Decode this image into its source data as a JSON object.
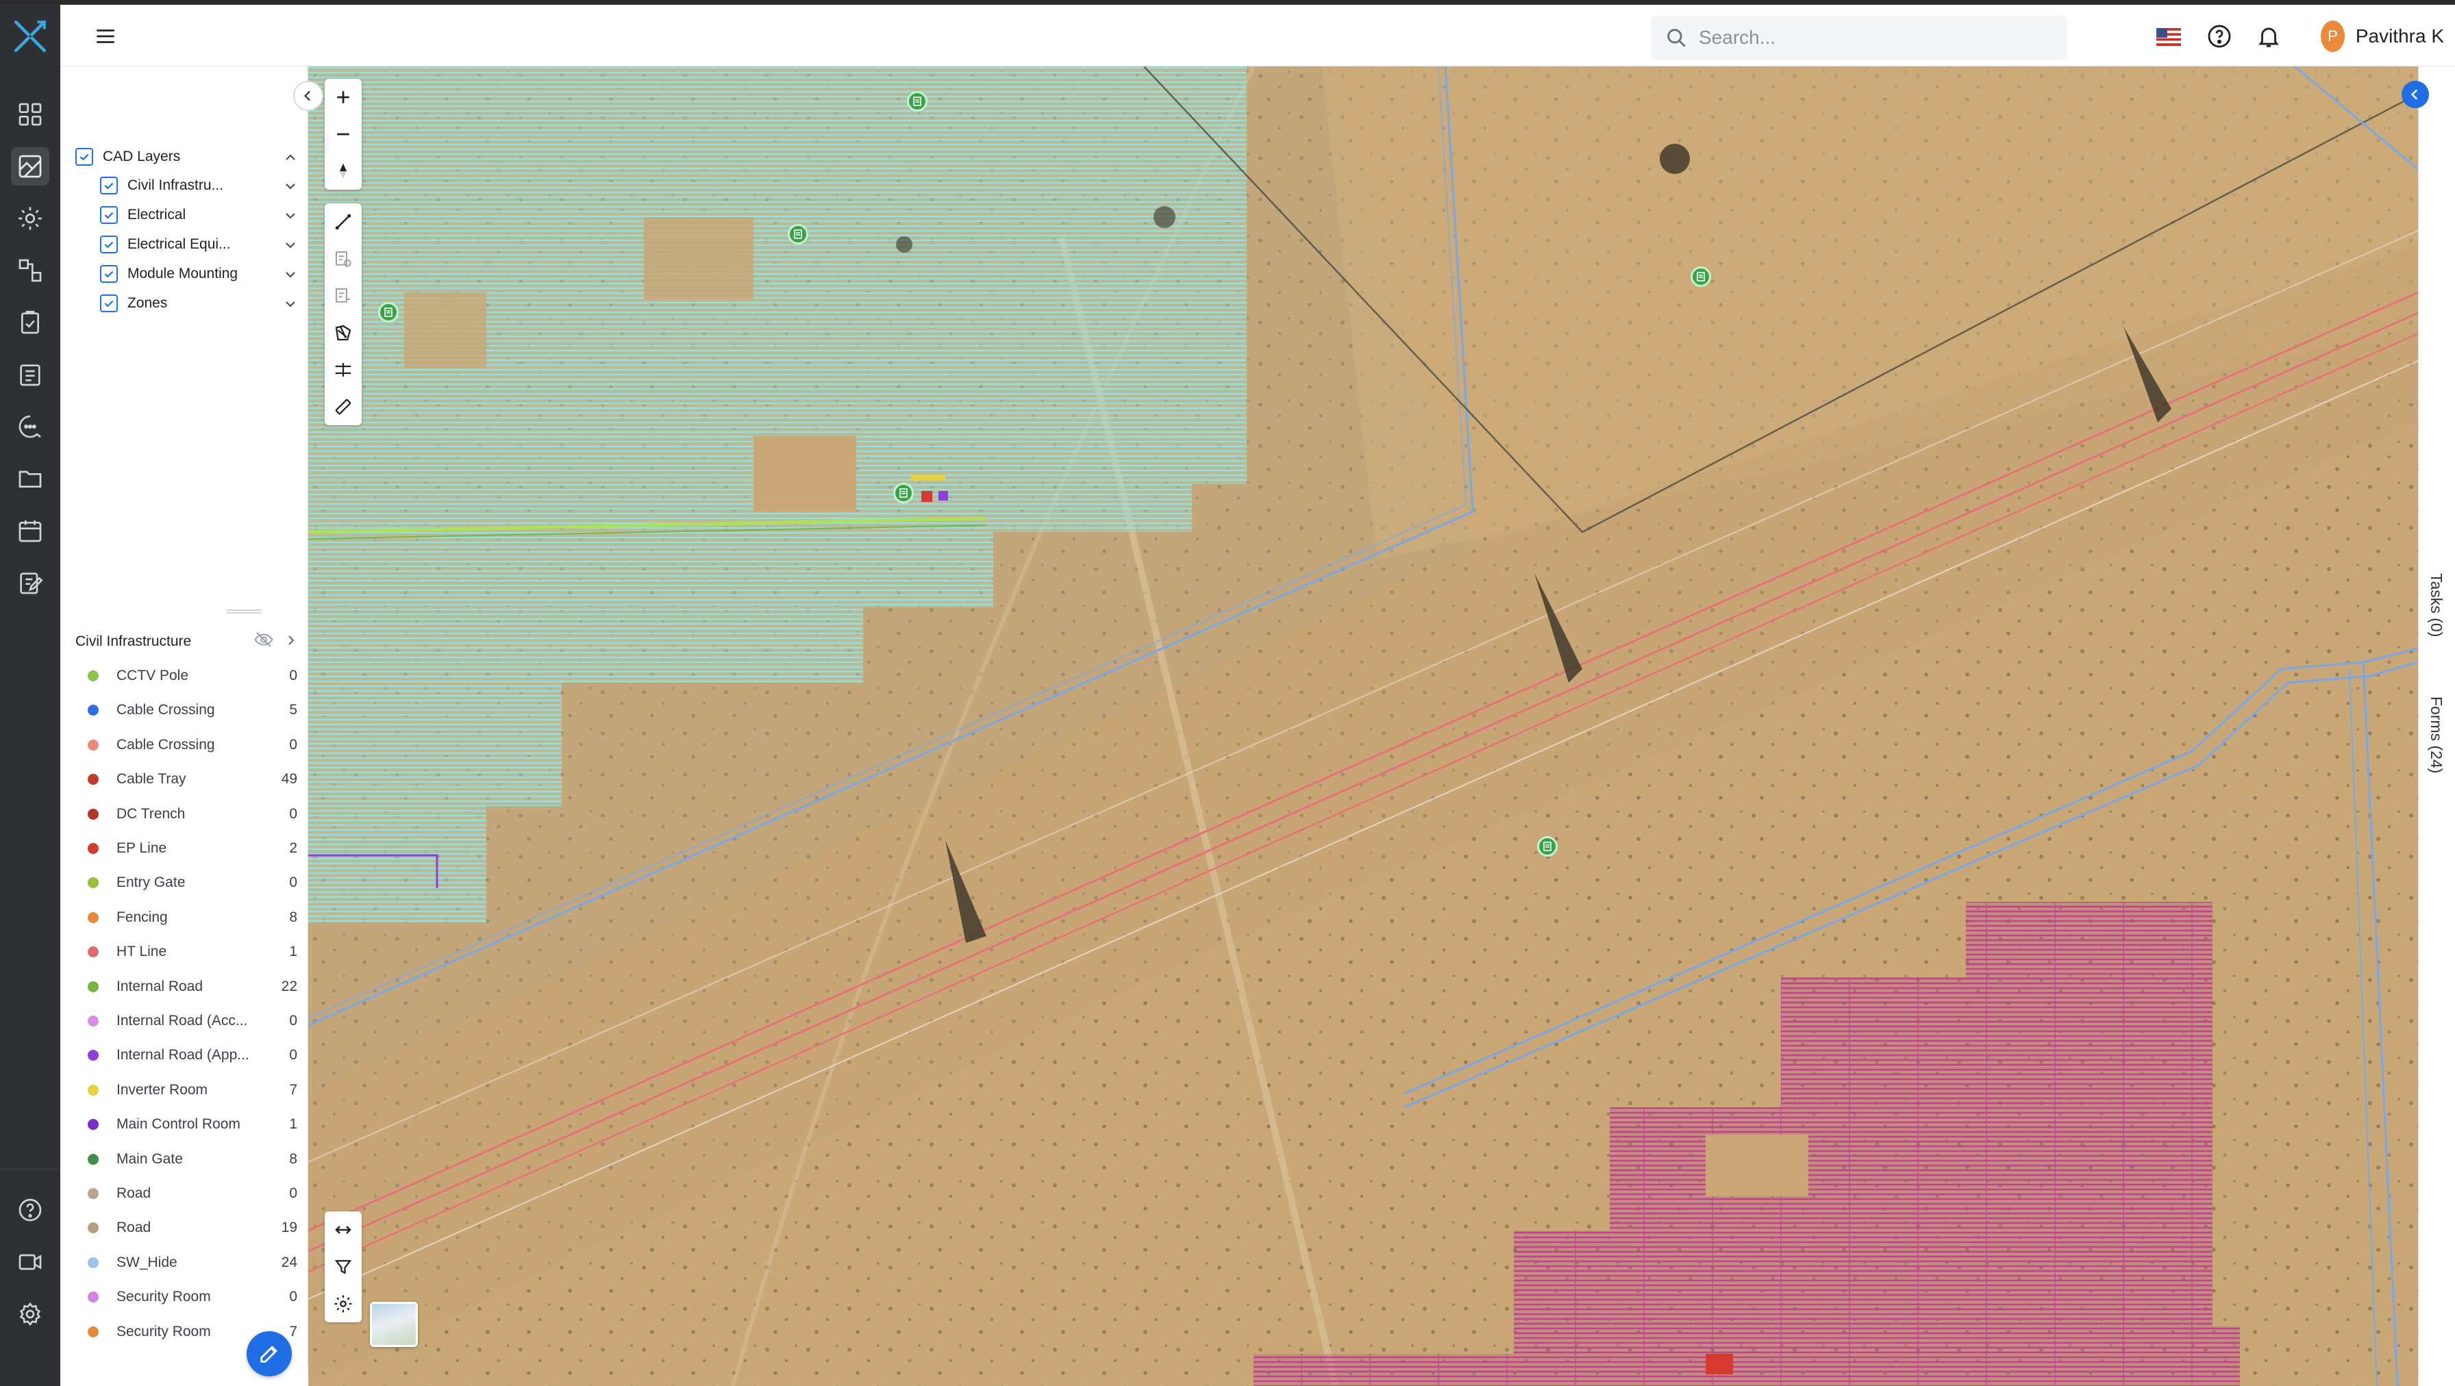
{
  "header": {
    "search_placeholder": "Search...",
    "user_initial": "P",
    "user_name": "Pavithra K"
  },
  "layers": {
    "root": {
      "label": "CAD Layers",
      "checked": true
    },
    "children": [
      {
        "label": "Civil Infrastru...",
        "checked": true
      },
      {
        "label": "Electrical",
        "checked": true
      },
      {
        "label": "Electrical Equi...",
        "checked": true
      },
      {
        "label": "Module Mounting",
        "checked": true
      },
      {
        "label": "Zones",
        "checked": true
      }
    ]
  },
  "legend": {
    "title": "Civil Infrastructure",
    "items": [
      {
        "label": "CCTV Pole",
        "count": "0",
        "color": "#8bc34a"
      },
      {
        "label": "Cable Crossing",
        "count": "5",
        "color": "#2f6fe4"
      },
      {
        "label": "Cable Crossing",
        "count": "0",
        "color": "#e8897a"
      },
      {
        "label": "Cable Tray",
        "count": "49",
        "color": "#c0392b"
      },
      {
        "label": "DC Trench",
        "count": "0",
        "color": "#b8332a"
      },
      {
        "label": "EP Line",
        "count": "2",
        "color": "#d63a2e"
      },
      {
        "label": "Entry Gate",
        "count": "0",
        "color": "#9bbf3b"
      },
      {
        "label": "Fencing",
        "count": "8",
        "color": "#e8893a"
      },
      {
        "label": "HT Line",
        "count": "1",
        "color": "#e06c6c"
      },
      {
        "label": "Internal Road",
        "count": "22",
        "color": "#7cb342"
      },
      {
        "label": "Internal Road (Acc...",
        "count": "0",
        "color": "#d98ee6"
      },
      {
        "label": "Internal Road (App...",
        "count": "0",
        "color": "#8e3fd6"
      },
      {
        "label": "Inverter Room",
        "count": "7",
        "color": "#e6d23a"
      },
      {
        "label": "Main Control Room",
        "count": "1",
        "color": "#7b2fc9"
      },
      {
        "label": "Main Gate",
        "count": "8",
        "color": "#3f8f4a"
      },
      {
        "label": "Road",
        "count": "0",
        "color": "#b9a58c"
      },
      {
        "label": "Road",
        "count": "19",
        "color": "#b59f84"
      },
      {
        "label": "SW_Hide",
        "count": "24",
        "color": "#9ec3ea"
      },
      {
        "label": "Security Room",
        "count": "0",
        "color": "#d383e0"
      },
      {
        "label": "Security Room",
        "count": "7",
        "color": "#e8893a"
      }
    ]
  },
  "side_tabs": {
    "tasks": "Tasks (0)",
    "forms": "Forms (24)"
  },
  "icons": {
    "logo": "logo-icon",
    "rail": [
      "dashboard-icon",
      "map-icon",
      "settings-gear-icon",
      "workflow-icon",
      "checklist-icon",
      "tasks-icon",
      "search-chat-icon",
      "folder-icon",
      "calendar-icon",
      "notes-icon",
      "help-icon",
      "video-icon",
      "admin-settings-icon"
    ]
  },
  "colors": {
    "rail_bg": "#2f3033",
    "accent": "#1f6ee6",
    "module_cyan": "#8fe3e0",
    "module_magenta": "#c2418c",
    "boundary_blue": "#7aa7e6",
    "ht_line_red": "#e8707a"
  }
}
